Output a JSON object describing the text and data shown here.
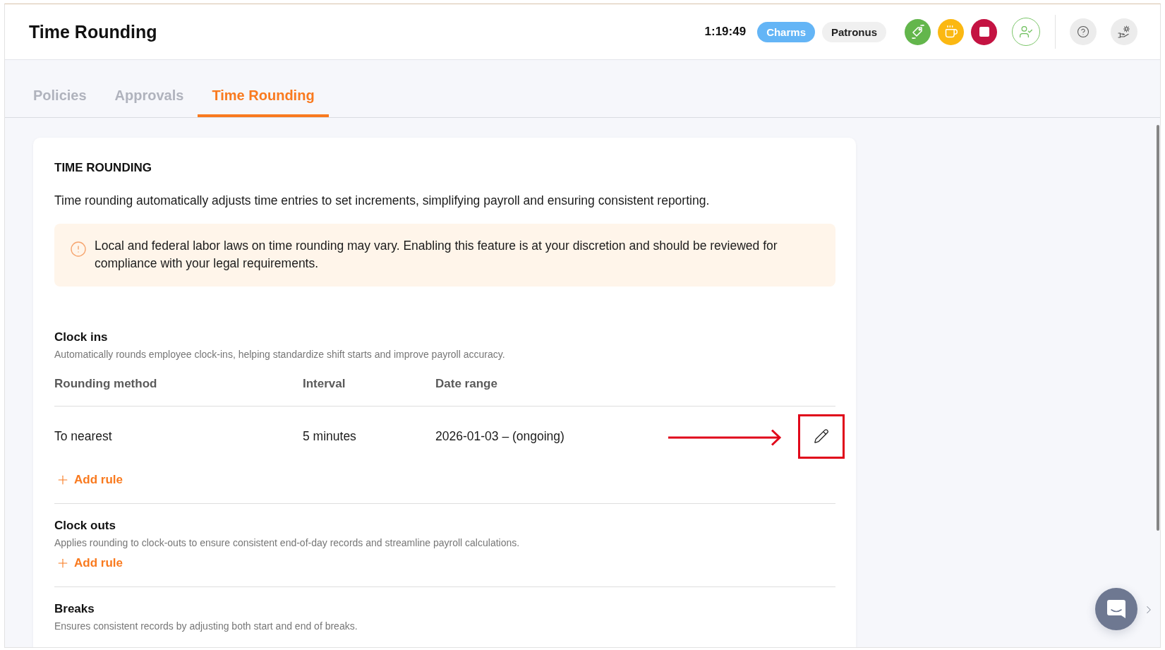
{
  "header": {
    "title": "Time Rounding",
    "timer": "1:19:49",
    "chips": [
      {
        "label": "Charms",
        "selected": true
      },
      {
        "label": "Patronus",
        "selected": false
      }
    ],
    "actions": [
      {
        "kind": "transfer"
      },
      {
        "kind": "break"
      },
      {
        "kind": "stop"
      },
      {
        "kind": "status"
      }
    ],
    "utilities": [
      {
        "kind": "help"
      },
      {
        "kind": "settings"
      }
    ]
  },
  "tabs": [
    {
      "label": "Policies",
      "selected": false
    },
    {
      "label": "Approvals",
      "selected": false
    },
    {
      "label": "Time Rounding",
      "selected": true
    }
  ],
  "card": {
    "title": "TIME ROUNDING",
    "description": "Time rounding automatically adjusts time entries to set increments, simplifying payroll and ensuring consistent reporting.",
    "notice": "Local and federal labor laws on time rounding may vary. Enabling this feature is at your discretion and should be reviewed for compliance with your legal requirements.",
    "sections": [
      {
        "title": "Clock ins",
        "subtitle": "Automatically rounds employee clock-ins, helping standardize shift starts and improve payroll accuracy.",
        "columns": [
          "Rounding method",
          "Interval",
          "Date range"
        ],
        "rows": [
          {
            "method": "To nearest",
            "interval": "5 minutes",
            "date_range": "2026-01-03 – (ongoing)",
            "highlighted": true
          }
        ],
        "add_label": "Add rule"
      },
      {
        "title": "Clock outs",
        "subtitle": "Applies rounding to clock-outs to ensure consistent end-of-day records and streamline payroll calculations.",
        "add_label": "Add rule"
      },
      {
        "title": "Breaks",
        "subtitle": "Ensures consistent records by adjusting both start and end of breaks."
      }
    ]
  }
}
